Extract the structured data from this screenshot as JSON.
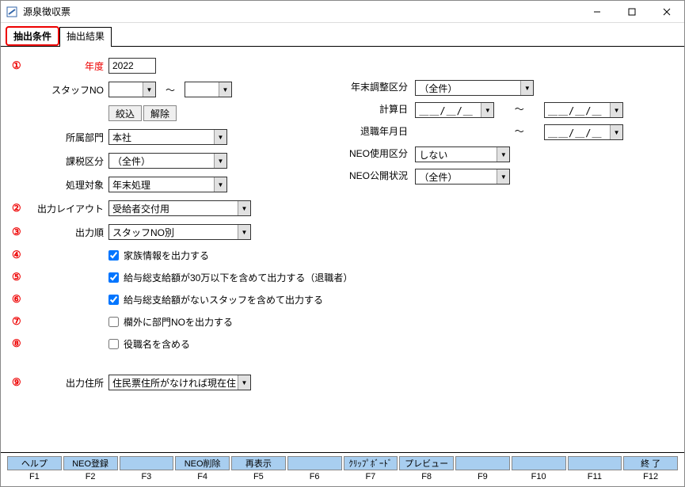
{
  "window": {
    "title": "源泉徴収票"
  },
  "tabs": [
    {
      "label": "抽出条件",
      "active": true
    },
    {
      "label": "抽出結果",
      "active": false
    }
  ],
  "markers": [
    "①",
    "②",
    "③",
    "④",
    "⑤",
    "⑥",
    "⑦",
    "⑧",
    "⑨"
  ],
  "form": {
    "year_label": "年度",
    "year_value": "2022",
    "staff_no_label": "スタッフNO",
    "staff_no_from": "",
    "staff_no_to": "",
    "filter_btn": "絞込",
    "clear_btn": "解除",
    "dept_label": "所属部門",
    "dept_value": "本社",
    "tax_class_label": "課税区分",
    "tax_class_value": "（全件）",
    "process_target_label": "処理対象",
    "process_target_value": "年末処理",
    "layout_label": "出力レイアウト",
    "layout_value": "受給者交付用",
    "order_label": "出力順",
    "order_value": "スタッフNO別",
    "address_label": "出力住所",
    "address_value": "住民票住所がなければ現在住",
    "adjust_class_label": "年末調整区分",
    "adjust_class_value": "（全件）",
    "calc_date_label": "計算日",
    "calc_date_from": "＿＿/＿/＿",
    "calc_date_to": "＿＿/＿/＿",
    "leave_date_label": "退職年月日",
    "leave_date_to": "＿＿/＿/＿",
    "neo_use_label": "NEO使用区分",
    "neo_use_value": "しない",
    "neo_pub_label": "NEO公開状況",
    "neo_pub_value": "（全件）"
  },
  "checkboxes": [
    {
      "label": "家族情報を出力する",
      "checked": true
    },
    {
      "label": "給与総支給額が30万以下を含めて出力する（退職者）",
      "checked": true
    },
    {
      "label": "給与総支給額がないスタッフを含めて出力する",
      "checked": true
    },
    {
      "label": "欄外に部門NOを出力する",
      "checked": false
    },
    {
      "label": "役職名を含める",
      "checked": false
    }
  ],
  "footer": {
    "buttons": [
      "ヘルプ",
      "NEO登録",
      "",
      "NEO削除",
      "再表示",
      "",
      "ｸﾘｯﾌﾟﾎﾞｰﾄﾞ",
      "プレビュー",
      "",
      "",
      "",
      "終 了"
    ],
    "labels": [
      "F1",
      "F2",
      "F3",
      "F4",
      "F5",
      "F6",
      "F7",
      "F8",
      "F9",
      "F10",
      "F11",
      "F12"
    ]
  }
}
